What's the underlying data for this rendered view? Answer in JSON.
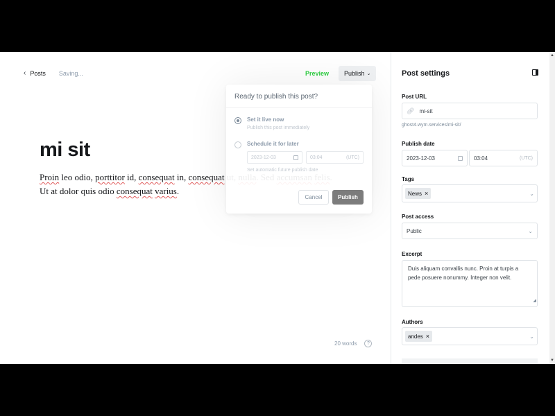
{
  "editor": {
    "back_label": "Posts",
    "status": "Saving...",
    "preview_label": "Preview",
    "publish_label": "Publish",
    "title": "mi sit",
    "body_parts": [
      {
        "t": "Proin",
        "sp": true
      },
      {
        "t": " leo odio, ",
        "sp": false
      },
      {
        "t": "porttitor",
        "sp": true
      },
      {
        "t": " id, ",
        "sp": false
      },
      {
        "t": "consequat",
        "sp": true
      },
      {
        "t": " in, ",
        "sp": false
      },
      {
        "t": "consequat",
        "sp": true
      },
      {
        "t": " ut, ",
        "sp": false
      },
      {
        "t": "nulla",
        "sp": true
      },
      {
        "t": ". Sed ",
        "sp": false
      },
      {
        "t": "accumsan",
        "sp": true
      },
      {
        "t": " ",
        "sp": false
      },
      {
        "t": "felis",
        "sp": true
      },
      {
        "t": ". Ut at dolor quis odio ",
        "sp": false
      },
      {
        "t": "consequat",
        "sp": true
      },
      {
        "t": " ",
        "sp": false
      },
      {
        "t": "varius",
        "sp": true
      },
      {
        "t": ".",
        "sp": false
      }
    ],
    "word_count": "20 words",
    "help": "?"
  },
  "publish_popover": {
    "heading": "Ready to publish this post?",
    "option_now_title": "Set it live now",
    "option_now_sub": "Publish this post immediately",
    "option_later_title": "Schedule it for later",
    "schedule_date": "2023-12-03",
    "schedule_time": "03:04",
    "schedule_tz": "(UTC)",
    "schedule_note": "Set automatic future publish date",
    "cancel_label": "Cancel",
    "publish_label": "Publish"
  },
  "settings": {
    "title": "Post settings",
    "url_label": "Post URL",
    "url_value": "mi-sit",
    "url_hint": "ghost4.wym.services/mi-sit/",
    "date_label": "Publish date",
    "date_value": "2023-12-03",
    "time_value": "03:04",
    "tz": "(UTC)",
    "tags_label": "Tags",
    "tags": [
      "News"
    ],
    "access_label": "Post access",
    "access_value": "Public",
    "excerpt_label": "Excerpt",
    "excerpt_value": "Duis aliquam convallis nunc. Proin at turpis a pede posuere nonummy. Integer non velit.",
    "authors_label": "Authors",
    "authors": [
      "andes"
    ]
  }
}
